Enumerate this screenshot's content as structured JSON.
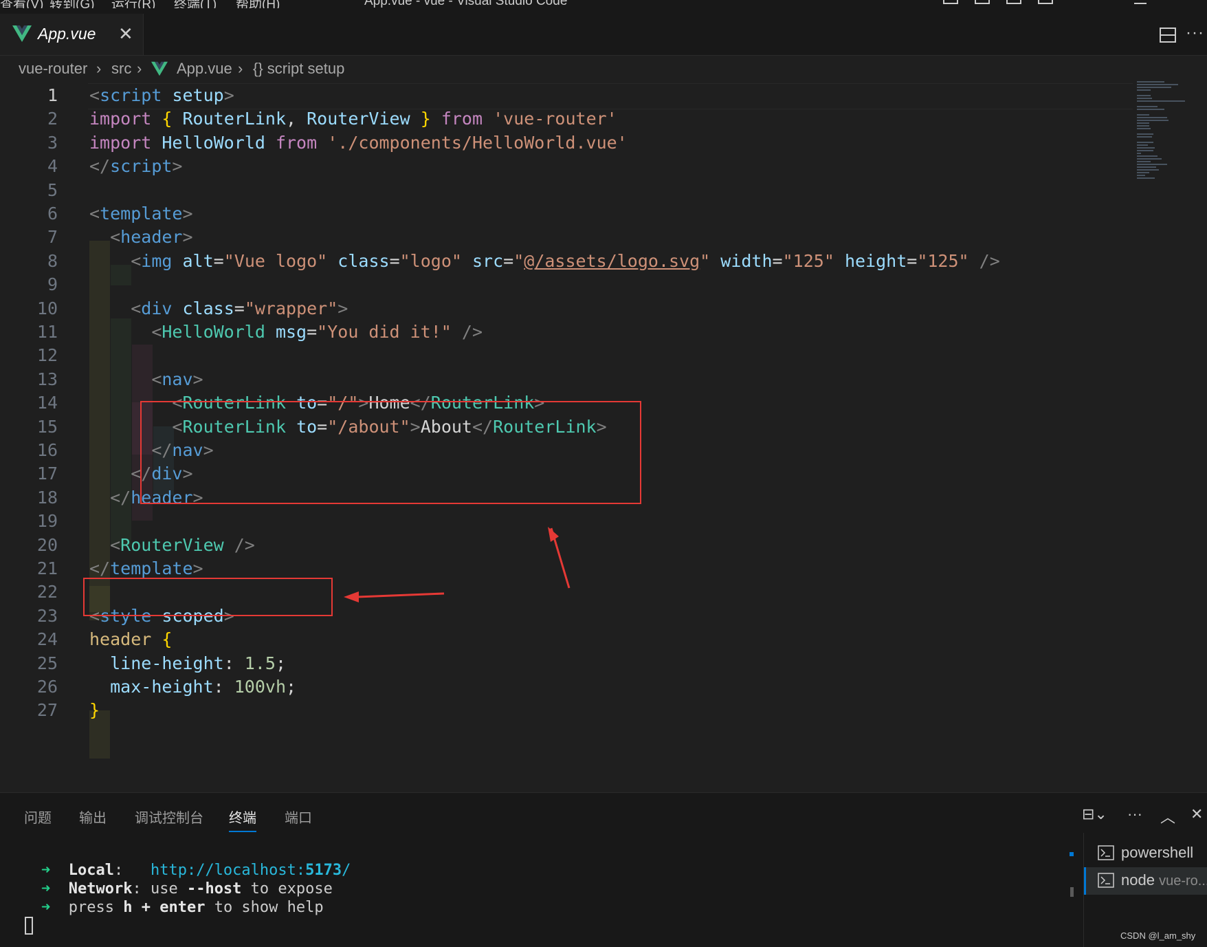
{
  "menubar": {
    "items": [
      "查看(V)",
      "转到(G)",
      "运行(R)",
      "终端(T)",
      "帮助(H)"
    ],
    "title": "App.vue - vue - Visual Studio Code"
  },
  "tabs": [
    {
      "label": "App.vue",
      "icon": "vue-icon",
      "active": true,
      "close": "✕"
    }
  ],
  "editor_actions": {
    "split": "split-editor-icon",
    "more": "···"
  },
  "breadcrumb": {
    "items": [
      "vue-router",
      "src",
      "App.vue",
      "{} script setup"
    ],
    "separator": "›"
  },
  "editor": {
    "active_line": 1,
    "line_numbers": [
      "1",
      "2",
      "3",
      "4",
      "5",
      "6",
      "7",
      "8",
      "9",
      "10",
      "11",
      "12",
      "13",
      "14",
      "15",
      "16",
      "17",
      "18",
      "19",
      "20",
      "21",
      "22",
      "23",
      "24",
      "25",
      "26",
      "27"
    ],
    "lines": [
      [
        [
          "b",
          "<"
        ],
        [
          "tag",
          "script"
        ],
        [
          "t",
          " "
        ],
        [
          "attr",
          "setup"
        ],
        [
          "b",
          ">"
        ]
      ],
      [
        [
          "kw",
          "import"
        ],
        [
          "t",
          " "
        ],
        [
          "brace",
          "{"
        ],
        [
          "t",
          " "
        ],
        [
          "var",
          "RouterLink"
        ],
        [
          "t",
          ", "
        ],
        [
          "var",
          "RouterView"
        ],
        [
          "t",
          " "
        ],
        [
          "brace",
          "}"
        ],
        [
          "t",
          " "
        ],
        [
          "kw",
          "from"
        ],
        [
          "t",
          " "
        ],
        [
          "str",
          "'vue-router'"
        ]
      ],
      [
        [
          "kw",
          "import"
        ],
        [
          "t",
          " "
        ],
        [
          "var",
          "HelloWorld"
        ],
        [
          "t",
          " "
        ],
        [
          "kw",
          "from"
        ],
        [
          "t",
          " "
        ],
        [
          "str",
          "'./components/HelloWorld.vue'"
        ]
      ],
      [
        [
          "b",
          "</"
        ],
        [
          "tag",
          "script"
        ],
        [
          "b",
          ">"
        ]
      ],
      [],
      [
        [
          "b",
          "<"
        ],
        [
          "tag",
          "template"
        ],
        [
          "b",
          ">"
        ]
      ],
      [
        [
          "t",
          "  "
        ],
        [
          "b",
          "<"
        ],
        [
          "tag",
          "header"
        ],
        [
          "b",
          ">"
        ]
      ],
      [
        [
          "t",
          "    "
        ],
        [
          "b",
          "<"
        ],
        [
          "tag",
          "img"
        ],
        [
          "t",
          " "
        ],
        [
          "attr",
          "alt"
        ],
        [
          "t",
          "="
        ],
        [
          "str",
          "\"Vue logo\""
        ],
        [
          "t",
          " "
        ],
        [
          "attr",
          "class"
        ],
        [
          "t",
          "="
        ],
        [
          "str",
          "\"logo\""
        ],
        [
          "t",
          " "
        ],
        [
          "attr",
          "src"
        ],
        [
          "t",
          "="
        ],
        [
          "str",
          "\""
        ],
        [
          "link",
          "@/assets/logo.svg"
        ],
        [
          "str",
          "\""
        ],
        [
          "t",
          " "
        ],
        [
          "attr",
          "width"
        ],
        [
          "t",
          "="
        ],
        [
          "str",
          "\"125\""
        ],
        [
          "t",
          " "
        ],
        [
          "attr",
          "height"
        ],
        [
          "t",
          "="
        ],
        [
          "str",
          "\"125\""
        ],
        [
          "t",
          " "
        ],
        [
          "b",
          "/>"
        ]
      ],
      [],
      [
        [
          "t",
          "    "
        ],
        [
          "b",
          "<"
        ],
        [
          "tag",
          "div"
        ],
        [
          "t",
          " "
        ],
        [
          "attr",
          "class"
        ],
        [
          "t",
          "="
        ],
        [
          "str",
          "\"wrapper\""
        ],
        [
          "b",
          ">"
        ]
      ],
      [
        [
          "t",
          "      "
        ],
        [
          "b",
          "<"
        ],
        [
          "comp",
          "HelloWorld"
        ],
        [
          "t",
          " "
        ],
        [
          "attr",
          "msg"
        ],
        [
          "t",
          "="
        ],
        [
          "str",
          "\"You did it!\""
        ],
        [
          "t",
          " "
        ],
        [
          "b",
          "/>"
        ]
      ],
      [],
      [
        [
          "t",
          "      "
        ],
        [
          "b",
          "<"
        ],
        [
          "tag",
          "nav"
        ],
        [
          "b",
          ">"
        ]
      ],
      [
        [
          "t",
          "        "
        ],
        [
          "b",
          "<"
        ],
        [
          "comp",
          "RouterLink"
        ],
        [
          "t",
          " "
        ],
        [
          "attr",
          "to"
        ],
        [
          "t",
          "="
        ],
        [
          "str",
          "\"/\""
        ],
        [
          "b",
          ">"
        ],
        [
          "t",
          "Home"
        ],
        [
          "b",
          "</"
        ],
        [
          "comp",
          "RouterLink"
        ],
        [
          "b",
          ">"
        ]
      ],
      [
        [
          "t",
          "        "
        ],
        [
          "b",
          "<"
        ],
        [
          "comp",
          "RouterLink"
        ],
        [
          "t",
          " "
        ],
        [
          "attr",
          "to"
        ],
        [
          "t",
          "="
        ],
        [
          "str",
          "\"/about\""
        ],
        [
          "b",
          ">"
        ],
        [
          "t",
          "About"
        ],
        [
          "b",
          "</"
        ],
        [
          "comp",
          "RouterLink"
        ],
        [
          "b",
          ">"
        ]
      ],
      [
        [
          "t",
          "      "
        ],
        [
          "b",
          "</"
        ],
        [
          "tag",
          "nav"
        ],
        [
          "b",
          ">"
        ]
      ],
      [
        [
          "t",
          "    "
        ],
        [
          "b",
          "</"
        ],
        [
          "tag",
          "div"
        ],
        [
          "b",
          ">"
        ]
      ],
      [
        [
          "t",
          "  "
        ],
        [
          "b",
          "</"
        ],
        [
          "tag",
          "header"
        ],
        [
          "b",
          ">"
        ]
      ],
      [],
      [
        [
          "t",
          "  "
        ],
        [
          "b",
          "<"
        ],
        [
          "comp",
          "RouterView"
        ],
        [
          "t",
          " "
        ],
        [
          "b",
          "/>"
        ]
      ],
      [
        [
          "b",
          "</"
        ],
        [
          "tag",
          "template"
        ],
        [
          "b",
          ">"
        ]
      ],
      [],
      [
        [
          "b",
          "<"
        ],
        [
          "tag",
          "style"
        ],
        [
          "t",
          " "
        ],
        [
          "attr",
          "scoped"
        ],
        [
          "b",
          ">"
        ]
      ],
      [
        [
          "sel",
          "header"
        ],
        [
          "t",
          " "
        ],
        [
          "brace",
          "{"
        ]
      ],
      [
        [
          "t",
          "  "
        ],
        [
          "attr",
          "line-height"
        ],
        [
          "t",
          ": "
        ],
        [
          "num",
          "1.5"
        ],
        [
          "t",
          ";"
        ]
      ],
      [
        [
          "t",
          "  "
        ],
        [
          "attr",
          "max-height"
        ],
        [
          "t",
          ": "
        ],
        [
          "num",
          "100vh"
        ],
        [
          "t",
          ";"
        ]
      ],
      [
        [
          "brace",
          "}"
        ]
      ]
    ]
  },
  "panel": {
    "tabs": [
      "问题",
      "输出",
      "调试控制台",
      "终端",
      "端口"
    ],
    "active_tab": "终端",
    "actions": {
      "split": "⊟⌄",
      "more": "···",
      "maximize": "︿",
      "close": "✕"
    },
    "terminal_output": [
      [
        [
          "arrow",
          "➜  "
        ],
        [
          "bold",
          "Local"
        ],
        [
          "t",
          ":   "
        ],
        [
          "url",
          "http://localhost:"
        ],
        [
          "urlb",
          "5173"
        ],
        [
          "url",
          "/"
        ]
      ],
      [
        [
          "arrow",
          "➜  "
        ],
        [
          "bold",
          "Network"
        ],
        [
          "t",
          ": use "
        ],
        [
          "bold",
          "--host"
        ],
        [
          "t",
          " to expose"
        ]
      ],
      [
        [
          "arrow",
          "➜  "
        ],
        [
          "t",
          "press "
        ],
        [
          "bold",
          "h + enter"
        ],
        [
          "t",
          " to show help"
        ]
      ]
    ],
    "terminals": [
      {
        "name": "powershell",
        "sub": "",
        "selected": false
      },
      {
        "name": "node",
        "sub": "vue-ro...",
        "selected": true
      }
    ]
  },
  "watermark": "CSDN @l_am_shy",
  "annotations": {
    "color": "#e53935"
  },
  "colors": {
    "background": "#1f1f1f",
    "tag": "#569cd6",
    "component": "#4ec9b0",
    "attribute": "#9cdcfe",
    "string": "#ce9178",
    "keyword": "#c586c0",
    "accent": "#0078d4"
  }
}
